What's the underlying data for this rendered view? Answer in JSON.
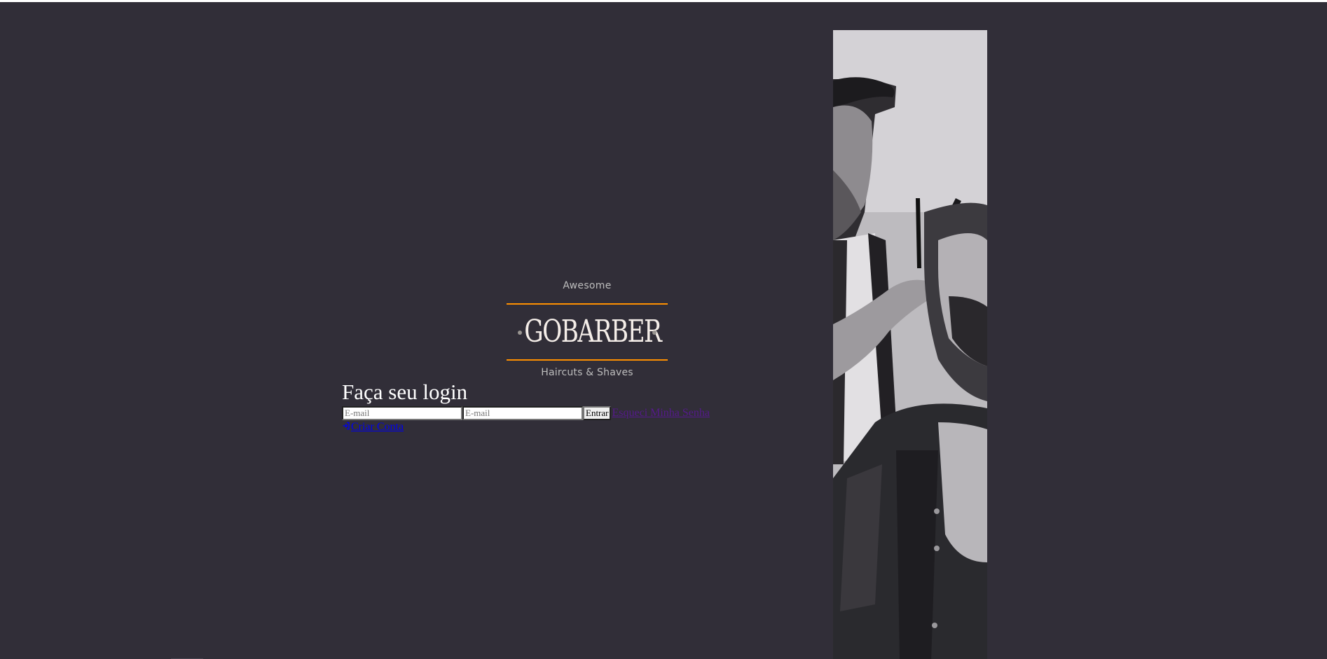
{
  "logo": {
    "tagline_top": "Awesome",
    "brand": "GOBARBER",
    "tagline_bottom": "Haircuts & Shaves",
    "accent_color": "#ff9000"
  },
  "login": {
    "title": "Faça seu login",
    "email_placeholder": "E-mail",
    "password_placeholder": "E-mail",
    "submit_label": "Entrar",
    "forgot_label": "Esqueci Minha Senha",
    "signup_label": "Criar Conta",
    "signup_icon": "log-in-icon"
  },
  "colors": {
    "background": "#312e38",
    "link": "#0000ee",
    "visited_link": "#551a8b"
  }
}
